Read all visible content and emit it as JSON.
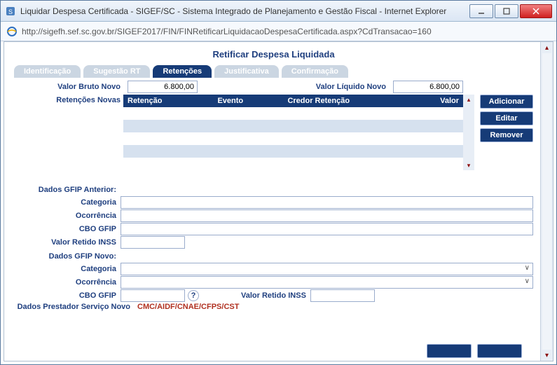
{
  "window": {
    "title": "Liquidar Despesa Certificada - SIGEF/SC - Sistema Integrado de Planejamento e Gestão Fiscal - Internet Explorer",
    "url": "http://sigefh.sef.sc.gov.br/SIGEF2017/FIN/FINRetificarLiquidacaoDespesaCertificada.aspx?CdTransacao=160"
  },
  "page": {
    "title": "Retificar Despesa Liquidada"
  },
  "tabs": {
    "identificacao": "Identificação",
    "sugestao": "Sugestão RT",
    "retencoes": "Retenções",
    "justificativa": "Justificativa",
    "confirmacao": "Confirmação"
  },
  "top": {
    "valor_bruto_label": "Valor Bruto Novo",
    "valor_bruto": "6.800,00",
    "valor_liquido_label": "Valor Líquido Novo",
    "valor_liquido": "6.800,00",
    "retencoes_novas_label": "Retenções Novas"
  },
  "table": {
    "h_retencao": "Retenção",
    "h_evento": "Evento",
    "h_credor": "Credor Retenção",
    "h_valor": "Valor"
  },
  "buttons": {
    "adicionar": "Adicionar",
    "editar": "Editar",
    "remover": "Remover"
  },
  "form": {
    "gfip_anterior": "Dados GFIP Anterior:",
    "categoria": "Categoria",
    "ocorrencia": "Ocorrência",
    "cbo_gfip": "CBO GFIP",
    "valor_retido_inss": "Valor Retido INSS",
    "gfip_novo": "Dados GFIP Novo:",
    "dados_prestador": "Dados Prestador Serviço Novo",
    "cmc_link": "CMC/AIDF/CNAE/CFPS/CST"
  }
}
